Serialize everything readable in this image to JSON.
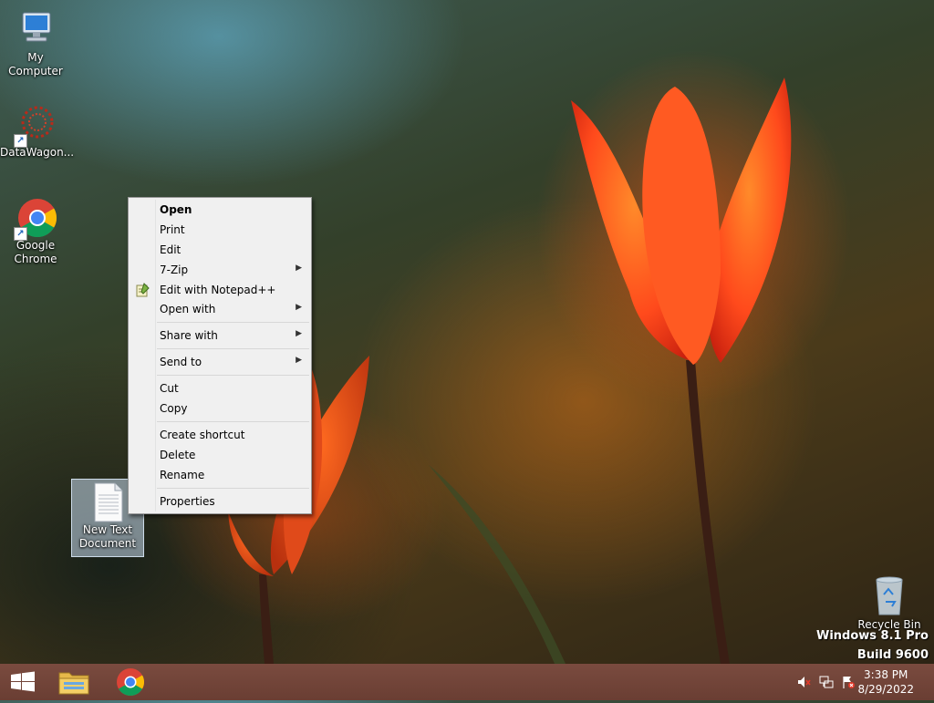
{
  "desktop": {
    "icons": [
      {
        "label": "My Computer"
      },
      {
        "label": "DataWagon..."
      },
      {
        "label": "Google Chrome"
      },
      {
        "label": "New Text Document"
      },
      {
        "label": "Recycle Bin"
      }
    ]
  },
  "context_menu": {
    "items": [
      {
        "label": "Open",
        "bold": true
      },
      {
        "label": "Print"
      },
      {
        "label": "Edit"
      },
      {
        "label": "7-Zip",
        "submenu": true
      },
      {
        "label": "Edit with Notepad++",
        "icon": "notepad-plus-plus-icon"
      },
      {
        "label": "Open with",
        "submenu": true
      },
      {
        "label": "Share with",
        "submenu": true
      },
      {
        "label": "Send to",
        "submenu": true
      },
      {
        "label": "Cut"
      },
      {
        "label": "Copy"
      },
      {
        "label": "Create shortcut"
      },
      {
        "label": "Delete"
      },
      {
        "label": "Rename"
      },
      {
        "label": "Properties"
      }
    ]
  },
  "watermark": {
    "line1": "Windows 8.1 Pro",
    "line2": "Build 9600"
  },
  "taskbar": {
    "pinned": [
      {
        "icon": "windows-start-icon"
      },
      {
        "icon": "file-explorer-icon"
      },
      {
        "icon": "chrome-icon"
      }
    ],
    "tray": [
      {
        "icon": "volume-muted-icon"
      },
      {
        "icon": "network-icon"
      },
      {
        "icon": "action-center-flag-icon"
      }
    ],
    "clock": {
      "time": "3:38 PM",
      "date": "8/29/2022"
    }
  },
  "colors": {
    "taskbar": "#6f4237",
    "menu_bg": "#f0f0f0",
    "tulip": "#ff4a1c"
  }
}
